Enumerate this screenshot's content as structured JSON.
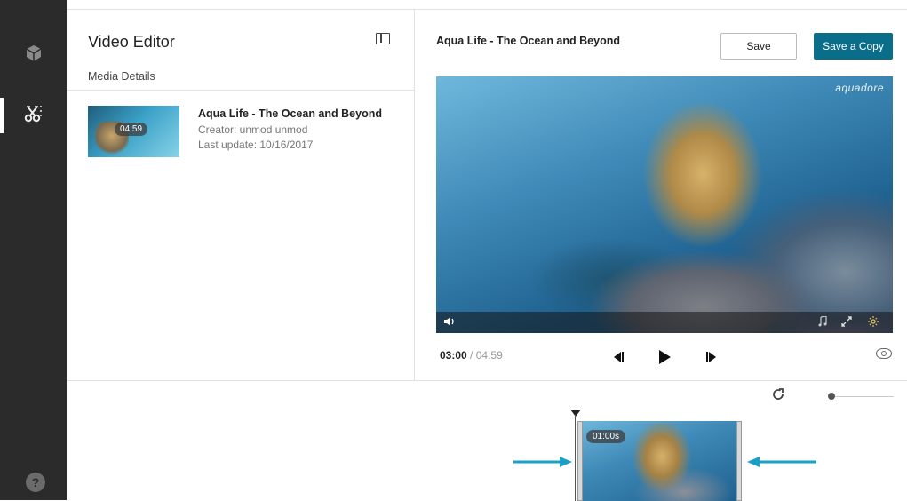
{
  "sidebar": {
    "items": [
      {
        "icon": "cube-icon",
        "active": false
      },
      {
        "icon": "scissors-icon",
        "active": true
      }
    ],
    "help_label": "?"
  },
  "left_panel": {
    "title": "Video Editor",
    "section_label": "Media Details",
    "media": {
      "title": "Aqua Life - The Ocean and Beyond",
      "duration_badge": "04:59",
      "creator": "Creator: unmod unmod",
      "last_update": "Last update: 10/16/2017"
    }
  },
  "editor": {
    "video_title": "Aqua Life - The Ocean and Beyond",
    "save_label": "Save",
    "save_copy_label": "Save a Copy",
    "player_logo": "aquadore",
    "current_time": "03:00",
    "total_time": "/ 04:59"
  },
  "timeline": {
    "clip_badge": "01:00s",
    "zoom_level": 0.05
  },
  "colors": {
    "sidebar_bg": "#2b2b2b",
    "accent": "#0a6e8a",
    "annotation_arrow": "#1aa0c6"
  }
}
